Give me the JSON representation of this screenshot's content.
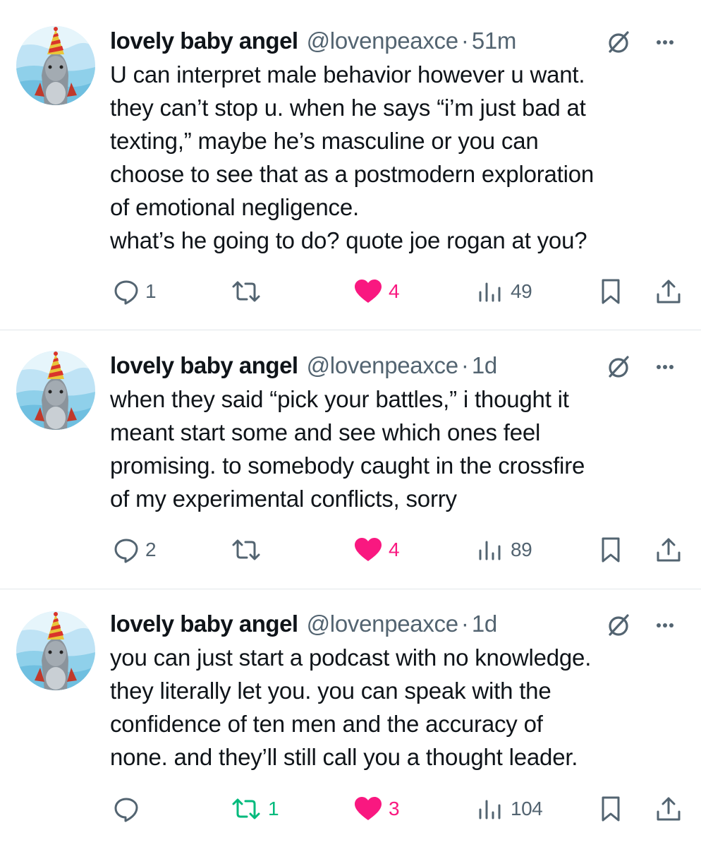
{
  "colors": {
    "accent_like": "#f91880",
    "accent_retweet": "#00ba7c",
    "muted": "#536471",
    "text": "#0f1419"
  },
  "tweets": [
    {
      "name": "lovely baby angel",
      "handle": "@lovenpeaxce",
      "separator": "·",
      "time": "51m",
      "lines": [
        "U can interpret male behavior however u want.",
        "they can’t stop u. when he says “i’m just bad at",
        "texting,” maybe he’s masculine or you can",
        "choose to see that as a postmodern exploration",
        "of emotional negligence.",
        "what’s he going to do? quote joe rogan at you?"
      ],
      "replies": "1",
      "retweets": "",
      "retweeted": false,
      "likes": "4",
      "liked": true,
      "views": "49"
    },
    {
      "name": "lovely baby angel",
      "handle": "@lovenpeaxce",
      "separator": "·",
      "time": "1d",
      "lines": [
        "when they said “pick your battles,” i thought it",
        "meant start some and see which ones feel",
        "promising. to somebody caught in the crossfire",
        "of my experimental conflicts, sorry"
      ],
      "replies": "2",
      "retweets": "",
      "retweeted": false,
      "likes": "4",
      "liked": true,
      "views": "89"
    },
    {
      "name": "lovely baby angel",
      "handle": "@lovenpeaxce",
      "separator": "·",
      "time": "1d",
      "lines": [
        "you can just start a podcast with no knowledge.",
        "they literally let you. you can speak with the",
        "confidence of ten men and the accuracy of",
        "none. and they’ll still call you a thought leader."
      ],
      "replies": "",
      "retweets": "1",
      "retweeted": true,
      "likes": "3",
      "liked": true,
      "views": "104"
    }
  ]
}
